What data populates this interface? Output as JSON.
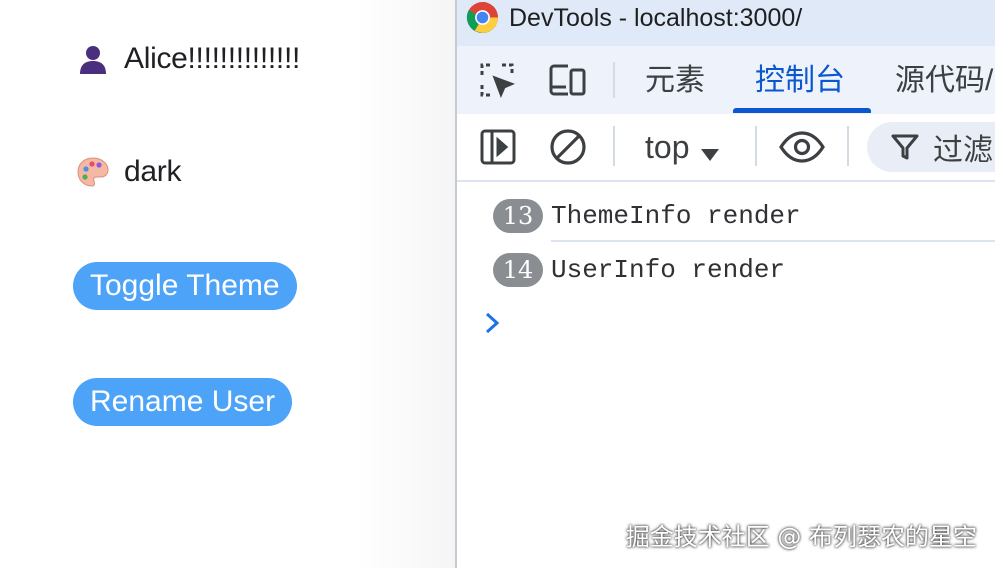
{
  "app": {
    "user_name": "Alice!!!!!!!!!!!!!!",
    "theme": "dark",
    "toggle_button": "Toggle Theme",
    "rename_button": "Rename User",
    "user_icon": "person-silhouette-icon",
    "theme_icon": "artist-palette-icon"
  },
  "devtools": {
    "window_title": "DevTools - localhost:3000/",
    "tabs": [
      {
        "label": "元素",
        "active": false
      },
      {
        "label": "控制台",
        "active": true
      },
      {
        "label": "源代码/",
        "active": false
      }
    ],
    "toolbar": {
      "context": "top",
      "filter_label": "过滤"
    },
    "console_messages": [
      {
        "count": "13",
        "text": "ThemeInfo render"
      },
      {
        "count": "14",
        "text": "UserInfo render"
      }
    ]
  },
  "watermark": "掘金技术社区 @ 布列瑟农的星空",
  "colors": {
    "button_bg": "#4da3f8",
    "active_tab": "#0b57d0",
    "titlebar_bg": "#dfe9f7",
    "badge_bg": "#8a8d91"
  }
}
